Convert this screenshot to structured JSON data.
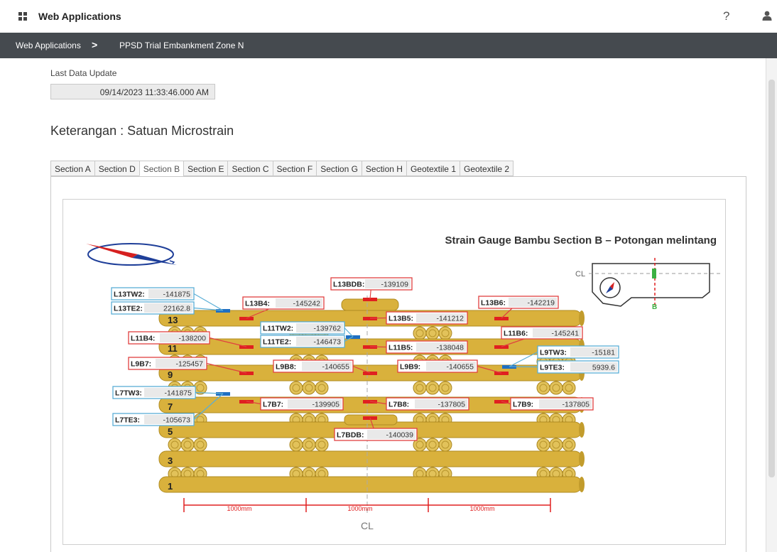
{
  "header": {
    "title": "Web Applications",
    "help_label": "?",
    "icons": [
      "grid-icon",
      "help-icon",
      "user-icon"
    ]
  },
  "breadcrumb": {
    "root": "Web Applications",
    "separator": ">",
    "current": "PPSD Trial Embankment Zone N"
  },
  "last_update": {
    "label": "Last Data Update",
    "value": "09/14/2023 11:33:46.000 AM"
  },
  "keterangan": "Keterangan : Satuan Microstrain",
  "tabs": [
    {
      "label": "Section A"
    },
    {
      "label": "Section D"
    },
    {
      "label": "Section B",
      "active": true
    },
    {
      "label": "Section E"
    },
    {
      "label": "Section C"
    },
    {
      "label": "Section F"
    },
    {
      "label": "Section G"
    },
    {
      "label": "Section H"
    },
    {
      "label": "Geotextile 1"
    },
    {
      "label": "Geotextile 2"
    }
  ],
  "diagram": {
    "title": "Strain Gauge Bambu Section B – Potongan melintang",
    "cl_label": "CL",
    "key_b_label": "B",
    "layers": [
      "13",
      "11",
      "9",
      "7",
      "5",
      "3",
      "1"
    ],
    "dimensions": [
      "1000mm",
      "1000mm",
      "1000mm"
    ],
    "colors": {
      "bamboo": "#d9b13c",
      "gauge_red": "#e02020",
      "gauge_blue": "#1f6fc2",
      "label_red": "#e04040",
      "label_blue": "#5aaed6"
    },
    "gauges": [
      {
        "name": "L13TW2:",
        "value": "-141875",
        "type": "blue"
      },
      {
        "name": "L13TE2:",
        "value": "22162.8",
        "type": "blue"
      },
      {
        "name": "L13B4:",
        "value": "-145242",
        "type": "red"
      },
      {
        "name": "L13BDB:",
        "value": "-139109",
        "type": "red"
      },
      {
        "name": "L13B6:",
        "value": "-142219",
        "type": "red"
      },
      {
        "name": "L13B5:",
        "value": "-141212",
        "type": "red"
      },
      {
        "name": "L11TW2:",
        "value": "-139762",
        "type": "blue"
      },
      {
        "name": "L11TE2:",
        "value": "-146473",
        "type": "blue"
      },
      {
        "name": "L11B4:",
        "value": "-138200",
        "type": "red"
      },
      {
        "name": "L11B6:",
        "value": "-145241",
        "type": "red"
      },
      {
        "name": "L11B5:",
        "value": "-138048",
        "type": "red"
      },
      {
        "name": "L9TW3:",
        "value": "-15181",
        "type": "blue"
      },
      {
        "name": "L9TE3:",
        "value": "5939.6",
        "type": "blue"
      },
      {
        "name": "L9B7:",
        "value": "-125457",
        "type": "red"
      },
      {
        "name": "L9B8:",
        "value": "-140655",
        "type": "red"
      },
      {
        "name": "L9B9:",
        "value": "-140655",
        "type": "red"
      },
      {
        "name": "L7TW3:",
        "value": "-141875",
        "type": "blue"
      },
      {
        "name": "L7TE3:",
        "value": "-105673",
        "type": "blue"
      },
      {
        "name": "L7B7:",
        "value": "-139905",
        "type": "red"
      },
      {
        "name": "L7B8:",
        "value": "-137805",
        "type": "red"
      },
      {
        "name": "L7B9:",
        "value": "-137805",
        "type": "red"
      },
      {
        "name": "L7BDB:",
        "value": "-140039",
        "type": "red"
      }
    ]
  }
}
